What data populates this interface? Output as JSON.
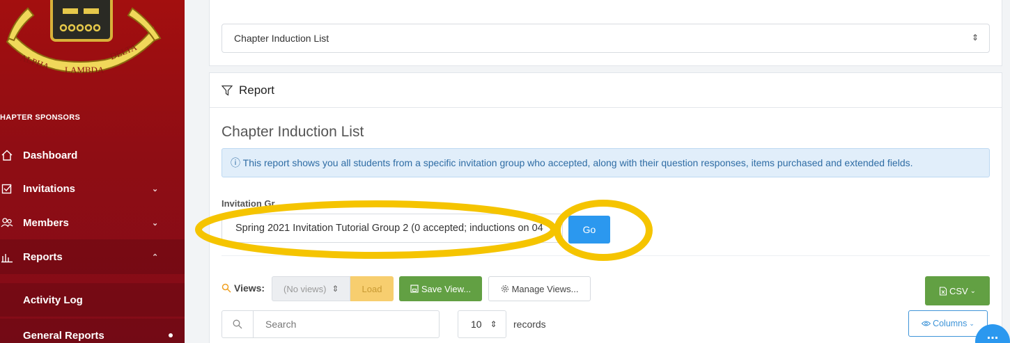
{
  "sidebar": {
    "logo": {
      "text_left": "ALPHA",
      "text_bottom": "LAMBDA",
      "text_right": "DELTA"
    },
    "section_title": "HAPTER SPONSORS",
    "items": [
      {
        "label": "Dashboard",
        "icon": "home-icon"
      },
      {
        "label": "Invitations",
        "icon": "checkbox-icon",
        "chevron": "⌄"
      },
      {
        "label": "Members",
        "icon": "users-icon",
        "chevron": "⌄"
      },
      {
        "label": "Reports",
        "icon": "bar-chart-icon",
        "chevron": "⌃"
      }
    ],
    "subitems": [
      {
        "label": "Activity Log"
      },
      {
        "label": "General Reports"
      }
    ],
    "colors": {
      "bg": "#a30f0f"
    }
  },
  "report_select": {
    "value": "Chapter Induction List",
    "caret": "⇕"
  },
  "report_card": {
    "header_title": "Report",
    "page_title": "Chapter Induction List",
    "info_text": "ⓘ This report shows you all students from a specific invitation group who accepted, along with their question responses, items purchased and extended fields.",
    "field_label": "Invitation Gr",
    "group_select_value": "Spring 2021 Invitation Tutorial Group 2 (0 accepted; inductions on 04",
    "go_label": "Go"
  },
  "toolbar": {
    "views_label": "Views:",
    "views_select": "(No views)",
    "load_label": "Load",
    "save_view_label": "Save View...",
    "manage_views_label": "Manage Views...",
    "csv_label": "CSV",
    "search_placeholder": "Search",
    "records_value": "10",
    "records_label": "records",
    "columns_label": "Columns"
  },
  "fab_label": "...",
  "colors": {
    "accent": "#2b98ef",
    "success": "#62a043",
    "warning": "#f7ce6f",
    "annotation": "#f5c400"
  }
}
